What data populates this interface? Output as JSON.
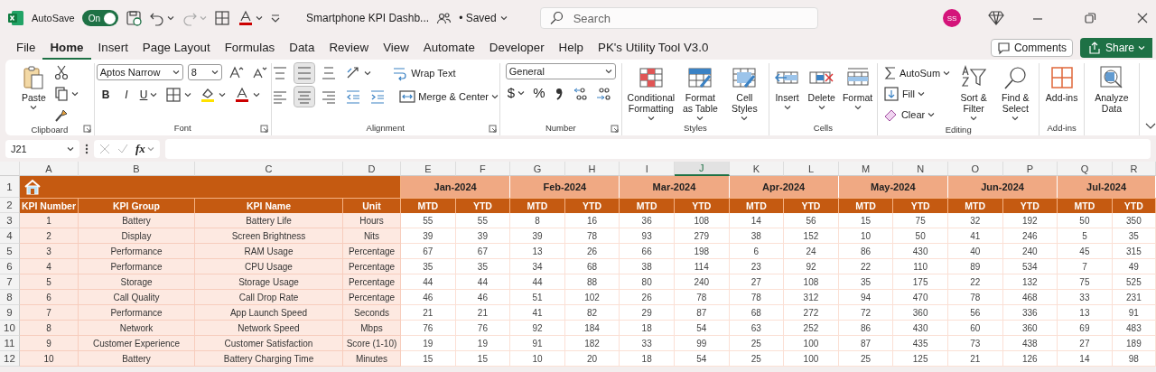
{
  "title_bar": {
    "autosave_label": "AutoSave",
    "autosave": {
      "on": true,
      "label": "On"
    },
    "redo": {
      "disabled": true
    },
    "document_title": "Smartphone KPI Dashb...",
    "save_status": "• Saved",
    "search": {
      "placeholder": "Search"
    },
    "user_initials": "SS"
  },
  "menu_tabs": [
    {
      "label": "File",
      "selected": false
    },
    {
      "label": "Home",
      "selected": true
    },
    {
      "label": "Insert",
      "selected": false
    },
    {
      "label": "Page Layout",
      "selected": false
    },
    {
      "label": "Formulas",
      "selected": false
    },
    {
      "label": "Data",
      "selected": false
    },
    {
      "label": "Review",
      "selected": false
    },
    {
      "label": "View",
      "selected": false
    },
    {
      "label": "Automate",
      "selected": false
    },
    {
      "label": "Developer",
      "selected": false
    },
    {
      "label": "Help",
      "selected": false
    },
    {
      "label": "PK's Utility Tool V3.0",
      "selected": false
    }
  ],
  "comments_button": "Comments",
  "share_button": "Share",
  "ribbon": {
    "clipboard": {
      "label": "Clipboard",
      "paste": "Paste"
    },
    "font": {
      "label": "Font",
      "font_name": "Aptos Narrow",
      "font_size": "8",
      "bold": "B",
      "italic": "I",
      "underline": "U"
    },
    "alignment": {
      "label": "Alignment",
      "wrap_text": "Wrap Text",
      "merge_center": "Merge & Center",
      "align_buttons": [
        {
          "on": false
        },
        {
          "on": true
        },
        {
          "on": false
        },
        {
          "on": false
        },
        {
          "on": true
        },
        {
          "on": false
        }
      ]
    },
    "number": {
      "label": "Number",
      "format": "General",
      "currency": "$",
      "percent": "%"
    },
    "styles": {
      "label": "Styles",
      "buttons": [
        "Conditional Formatting",
        "Format as Table",
        "Cell Styles"
      ]
    },
    "cells": {
      "label": "Cells",
      "buttons": [
        "Insert",
        "Delete",
        "Format"
      ]
    },
    "editing": {
      "label": "Editing",
      "autosum": "AutoSum",
      "fill": "Fill",
      "clear": "Clear",
      "sort_filter": "Sort & Filter",
      "find_select": "Find & Select"
    },
    "addins": {
      "label": "Add-ins",
      "button": "Add-ins"
    },
    "analyze": {
      "button": "Analyze Data"
    }
  },
  "formula_bar": {
    "name_box": "J21",
    "fx": "fx"
  },
  "sheet": {
    "columns": [
      {
        "label": "A",
        "selected": false
      },
      {
        "label": "B",
        "selected": false
      },
      {
        "label": "C",
        "selected": false
      },
      {
        "label": "D",
        "selected": false
      },
      {
        "label": "E",
        "selected": false
      },
      {
        "label": "F",
        "selected": false
      },
      {
        "label": "G",
        "selected": false
      },
      {
        "label": "H",
        "selected": false
      },
      {
        "label": "I",
        "selected": false
      },
      {
        "label": "J",
        "selected": true
      },
      {
        "label": "K",
        "selected": false
      },
      {
        "label": "L",
        "selected": false
      },
      {
        "label": "M",
        "selected": false
      },
      {
        "label": "N",
        "selected": false
      },
      {
        "label": "O",
        "selected": false
      },
      {
        "label": "P",
        "selected": false
      },
      {
        "label": "Q",
        "selected": false
      },
      {
        "label": "R",
        "selected": false
      }
    ],
    "row_numbers": [
      "1",
      "2",
      "3",
      "4",
      "5",
      "6",
      "7",
      "8",
      "9",
      "10",
      "11",
      "12"
    ],
    "months": [
      "Jan-2024",
      "Feb-2024",
      "Mar-2024",
      "Apr-2024",
      "May-2024",
      "Jun-2024",
      "Jul-2024"
    ],
    "headers": [
      "KPI Number",
      "KPI Group",
      "KPI Name",
      "Unit",
      "MTD",
      "YTD",
      "MTD",
      "YTD",
      "MTD",
      "YTD",
      "MTD",
      "YTD",
      "MTD",
      "YTD",
      "MTD",
      "YTD",
      "MTD",
      "YTD"
    ],
    "rows": [
      {
        "kpi_number": "1",
        "group": "Battery",
        "name": "Battery Life",
        "unit": "Hours",
        "values": [
          "55",
          "55",
          "8",
          "16",
          "36",
          "108",
          "14",
          "56",
          "15",
          "75",
          "32",
          "192",
          "50",
          "350"
        ]
      },
      {
        "kpi_number": "2",
        "group": "Display",
        "name": "Screen Brightness",
        "unit": "Nits",
        "values": [
          "39",
          "39",
          "39",
          "78",
          "93",
          "279",
          "38",
          "152",
          "10",
          "50",
          "41",
          "246",
          "5",
          "35"
        ]
      },
      {
        "kpi_number": "3",
        "group": "Performance",
        "name": "RAM Usage",
        "unit": "Percentage",
        "values": [
          "67",
          "67",
          "13",
          "26",
          "66",
          "198",
          "6",
          "24",
          "86",
          "430",
          "40",
          "240",
          "45",
          "315"
        ]
      },
      {
        "kpi_number": "4",
        "group": "Performance",
        "name": "CPU Usage",
        "unit": "Percentage",
        "values": [
          "35",
          "35",
          "34",
          "68",
          "38",
          "114",
          "23",
          "92",
          "22",
          "110",
          "89",
          "534",
          "7",
          "49"
        ]
      },
      {
        "kpi_number": "5",
        "group": "Storage",
        "name": "Storage Usage",
        "unit": "Percentage",
        "values": [
          "44",
          "44",
          "44",
          "88",
          "80",
          "240",
          "27",
          "108",
          "35",
          "175",
          "22",
          "132",
          "75",
          "525"
        ]
      },
      {
        "kpi_number": "6",
        "group": "Call Quality",
        "name": "Call Drop Rate",
        "unit": "Percentage",
        "values": [
          "46",
          "46",
          "51",
          "102",
          "26",
          "78",
          "78",
          "312",
          "94",
          "470",
          "78",
          "468",
          "33",
          "231"
        ]
      },
      {
        "kpi_number": "7",
        "group": "Performance",
        "name": "App Launch Speed",
        "unit": "Seconds",
        "values": [
          "21",
          "21",
          "41",
          "82",
          "29",
          "87",
          "68",
          "272",
          "72",
          "360",
          "56",
          "336",
          "13",
          "91"
        ]
      },
      {
        "kpi_number": "8",
        "group": "Network",
        "name": "Network Speed",
        "unit": "Mbps",
        "values": [
          "76",
          "76",
          "92",
          "184",
          "18",
          "54",
          "63",
          "252",
          "86",
          "430",
          "60",
          "360",
          "69",
          "483"
        ]
      },
      {
        "kpi_number": "9",
        "group": "Customer Experience",
        "name": "Customer Satisfaction",
        "unit": "Score (1-10)",
        "values": [
          "19",
          "19",
          "91",
          "182",
          "33",
          "99",
          "25",
          "100",
          "87",
          "435",
          "73",
          "438",
          "27",
          "189"
        ]
      },
      {
        "kpi_number": "10",
        "group": "Battery",
        "name": "Battery Charging Time",
        "unit": "Minutes",
        "values": [
          "15",
          "15",
          "10",
          "20",
          "18",
          "54",
          "25",
          "100",
          "25",
          "125",
          "21",
          "126",
          "14",
          "98"
        ]
      }
    ]
  }
}
